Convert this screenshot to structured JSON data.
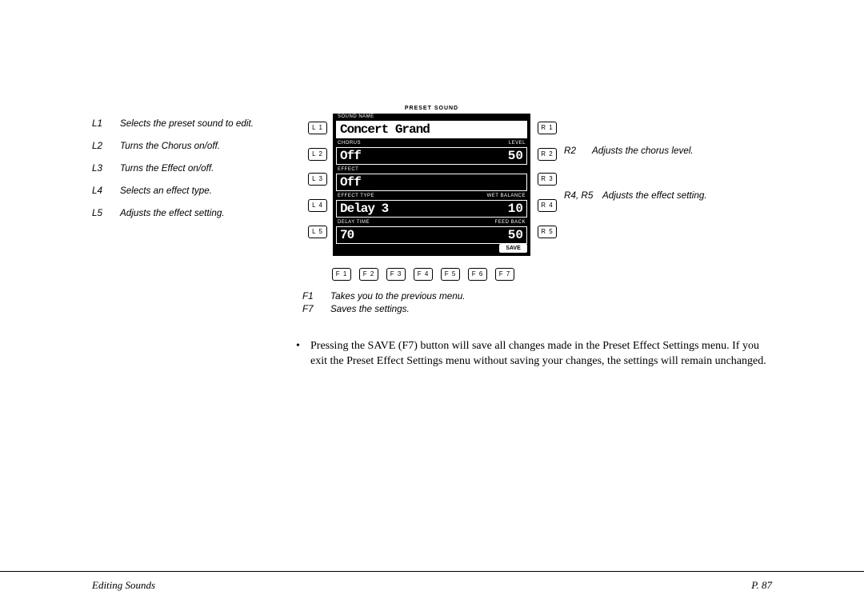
{
  "lcd": {
    "header": "PRESET SOUND",
    "rows": [
      {
        "leftLabel": "SOUND NAME",
        "rightLabel": "",
        "main": "Concert Grand",
        "num": "",
        "style": "light"
      },
      {
        "leftLabel": "CHORUS",
        "rightLabel": "LEVEL",
        "main": "Off",
        "num": "50",
        "style": "dark"
      },
      {
        "leftLabel": "EFFECT",
        "rightLabel": "",
        "main": "Off",
        "num": "",
        "style": "dark"
      },
      {
        "leftLabel": "EFFECT TYPE",
        "rightLabel": "WET BALANCE",
        "main": "Delay 3",
        "num": "10",
        "style": "dark"
      },
      {
        "leftLabel": "DELAY TIME",
        "rightLabel": "FEED BACK",
        "main": "70",
        "num": "50",
        "style": "dark"
      }
    ],
    "save": "SAVE"
  },
  "sideButtons": {
    "L1": "L 1",
    "L2": "L 2",
    "L3": "L 3",
    "L4": "L 4",
    "L5": "L 5",
    "R1": "R 1",
    "R2": "R 2",
    "R3": "R 3",
    "R4": "R 4",
    "R5": "R 5"
  },
  "fButtons": [
    "F 1",
    "F 2",
    "F 3",
    "F 4",
    "F 5",
    "F 6",
    "F 7"
  ],
  "annLeft": [
    {
      "k": "L1",
      "v": "Selects the preset sound to edit."
    },
    {
      "k": "L2",
      "v": "Turns the Chorus on/off."
    },
    {
      "k": "L3",
      "v": "Turns the Effect on/off."
    },
    {
      "k": "L4",
      "v": "Selects an effect type."
    },
    {
      "k": "L5",
      "v": "Adjusts the effect setting."
    }
  ],
  "annRight": [
    {
      "k": "R2",
      "v": "Adjusts the chorus level."
    },
    {
      "k": "R4, R5",
      "v": "Adjusts the effect setting."
    }
  ],
  "annBottom": [
    {
      "k": "F1",
      "v": "Takes you to the previous menu."
    },
    {
      "k": "F7",
      "v": "Saves the settings."
    }
  ],
  "bodyText": "Pressing the SAVE (F7) button will save all changes made in the Preset Effect Settings menu.  If you exit the Preset Effect Settings menu without saving your changes, the settings will remain unchanged.",
  "footer": {
    "left": "Editing Sounds",
    "right": "P. 87"
  }
}
